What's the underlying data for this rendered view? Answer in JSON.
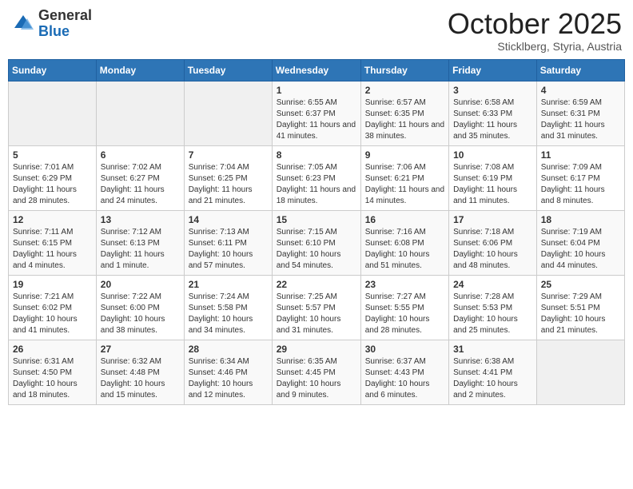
{
  "header": {
    "logo": {
      "general": "General",
      "blue": "Blue"
    },
    "title": "October 2025",
    "location": "Sticklberg, Styria, Austria"
  },
  "days_of_week": [
    "Sunday",
    "Monday",
    "Tuesday",
    "Wednesday",
    "Thursday",
    "Friday",
    "Saturday"
  ],
  "weeks": [
    [
      {
        "day": "",
        "sunrise": "",
        "sunset": "",
        "daylight": "",
        "empty": true
      },
      {
        "day": "",
        "sunrise": "",
        "sunset": "",
        "daylight": "",
        "empty": true
      },
      {
        "day": "",
        "sunrise": "",
        "sunset": "",
        "daylight": "",
        "empty": true
      },
      {
        "day": "1",
        "sunrise": "Sunrise: 6:55 AM",
        "sunset": "Sunset: 6:37 PM",
        "daylight": "Daylight: 11 hours and 41 minutes."
      },
      {
        "day": "2",
        "sunrise": "Sunrise: 6:57 AM",
        "sunset": "Sunset: 6:35 PM",
        "daylight": "Daylight: 11 hours and 38 minutes."
      },
      {
        "day": "3",
        "sunrise": "Sunrise: 6:58 AM",
        "sunset": "Sunset: 6:33 PM",
        "daylight": "Daylight: 11 hours and 35 minutes."
      },
      {
        "day": "4",
        "sunrise": "Sunrise: 6:59 AM",
        "sunset": "Sunset: 6:31 PM",
        "daylight": "Daylight: 11 hours and 31 minutes."
      }
    ],
    [
      {
        "day": "5",
        "sunrise": "Sunrise: 7:01 AM",
        "sunset": "Sunset: 6:29 PM",
        "daylight": "Daylight: 11 hours and 28 minutes."
      },
      {
        "day": "6",
        "sunrise": "Sunrise: 7:02 AM",
        "sunset": "Sunset: 6:27 PM",
        "daylight": "Daylight: 11 hours and 24 minutes."
      },
      {
        "day": "7",
        "sunrise": "Sunrise: 7:04 AM",
        "sunset": "Sunset: 6:25 PM",
        "daylight": "Daylight: 11 hours and 21 minutes."
      },
      {
        "day": "8",
        "sunrise": "Sunrise: 7:05 AM",
        "sunset": "Sunset: 6:23 PM",
        "daylight": "Daylight: 11 hours and 18 minutes."
      },
      {
        "day": "9",
        "sunrise": "Sunrise: 7:06 AM",
        "sunset": "Sunset: 6:21 PM",
        "daylight": "Daylight: 11 hours and 14 minutes."
      },
      {
        "day": "10",
        "sunrise": "Sunrise: 7:08 AM",
        "sunset": "Sunset: 6:19 PM",
        "daylight": "Daylight: 11 hours and 11 minutes."
      },
      {
        "day": "11",
        "sunrise": "Sunrise: 7:09 AM",
        "sunset": "Sunset: 6:17 PM",
        "daylight": "Daylight: 11 hours and 8 minutes."
      }
    ],
    [
      {
        "day": "12",
        "sunrise": "Sunrise: 7:11 AM",
        "sunset": "Sunset: 6:15 PM",
        "daylight": "Daylight: 11 hours and 4 minutes."
      },
      {
        "day": "13",
        "sunrise": "Sunrise: 7:12 AM",
        "sunset": "Sunset: 6:13 PM",
        "daylight": "Daylight: 11 hours and 1 minute."
      },
      {
        "day": "14",
        "sunrise": "Sunrise: 7:13 AM",
        "sunset": "Sunset: 6:11 PM",
        "daylight": "Daylight: 10 hours and 57 minutes."
      },
      {
        "day": "15",
        "sunrise": "Sunrise: 7:15 AM",
        "sunset": "Sunset: 6:10 PM",
        "daylight": "Daylight: 10 hours and 54 minutes."
      },
      {
        "day": "16",
        "sunrise": "Sunrise: 7:16 AM",
        "sunset": "Sunset: 6:08 PM",
        "daylight": "Daylight: 10 hours and 51 minutes."
      },
      {
        "day": "17",
        "sunrise": "Sunrise: 7:18 AM",
        "sunset": "Sunset: 6:06 PM",
        "daylight": "Daylight: 10 hours and 48 minutes."
      },
      {
        "day": "18",
        "sunrise": "Sunrise: 7:19 AM",
        "sunset": "Sunset: 6:04 PM",
        "daylight": "Daylight: 10 hours and 44 minutes."
      }
    ],
    [
      {
        "day": "19",
        "sunrise": "Sunrise: 7:21 AM",
        "sunset": "Sunset: 6:02 PM",
        "daylight": "Daylight: 10 hours and 41 minutes."
      },
      {
        "day": "20",
        "sunrise": "Sunrise: 7:22 AM",
        "sunset": "Sunset: 6:00 PM",
        "daylight": "Daylight: 10 hours and 38 minutes."
      },
      {
        "day": "21",
        "sunrise": "Sunrise: 7:24 AM",
        "sunset": "Sunset: 5:58 PM",
        "daylight": "Daylight: 10 hours and 34 minutes."
      },
      {
        "day": "22",
        "sunrise": "Sunrise: 7:25 AM",
        "sunset": "Sunset: 5:57 PM",
        "daylight": "Daylight: 10 hours and 31 minutes."
      },
      {
        "day": "23",
        "sunrise": "Sunrise: 7:27 AM",
        "sunset": "Sunset: 5:55 PM",
        "daylight": "Daylight: 10 hours and 28 minutes."
      },
      {
        "day": "24",
        "sunrise": "Sunrise: 7:28 AM",
        "sunset": "Sunset: 5:53 PM",
        "daylight": "Daylight: 10 hours and 25 minutes."
      },
      {
        "day": "25",
        "sunrise": "Sunrise: 7:29 AM",
        "sunset": "Sunset: 5:51 PM",
        "daylight": "Daylight: 10 hours and 21 minutes."
      }
    ],
    [
      {
        "day": "26",
        "sunrise": "Sunrise: 6:31 AM",
        "sunset": "Sunset: 4:50 PM",
        "daylight": "Daylight: 10 hours and 18 minutes."
      },
      {
        "day": "27",
        "sunrise": "Sunrise: 6:32 AM",
        "sunset": "Sunset: 4:48 PM",
        "daylight": "Daylight: 10 hours and 15 minutes."
      },
      {
        "day": "28",
        "sunrise": "Sunrise: 6:34 AM",
        "sunset": "Sunset: 4:46 PM",
        "daylight": "Daylight: 10 hours and 12 minutes."
      },
      {
        "day": "29",
        "sunrise": "Sunrise: 6:35 AM",
        "sunset": "Sunset: 4:45 PM",
        "daylight": "Daylight: 10 hours and 9 minutes."
      },
      {
        "day": "30",
        "sunrise": "Sunrise: 6:37 AM",
        "sunset": "Sunset: 4:43 PM",
        "daylight": "Daylight: 10 hours and 6 minutes."
      },
      {
        "day": "31",
        "sunrise": "Sunrise: 6:38 AM",
        "sunset": "Sunset: 4:41 PM",
        "daylight": "Daylight: 10 hours and 2 minutes."
      },
      {
        "day": "",
        "sunrise": "",
        "sunset": "",
        "daylight": "",
        "empty": true
      }
    ]
  ]
}
